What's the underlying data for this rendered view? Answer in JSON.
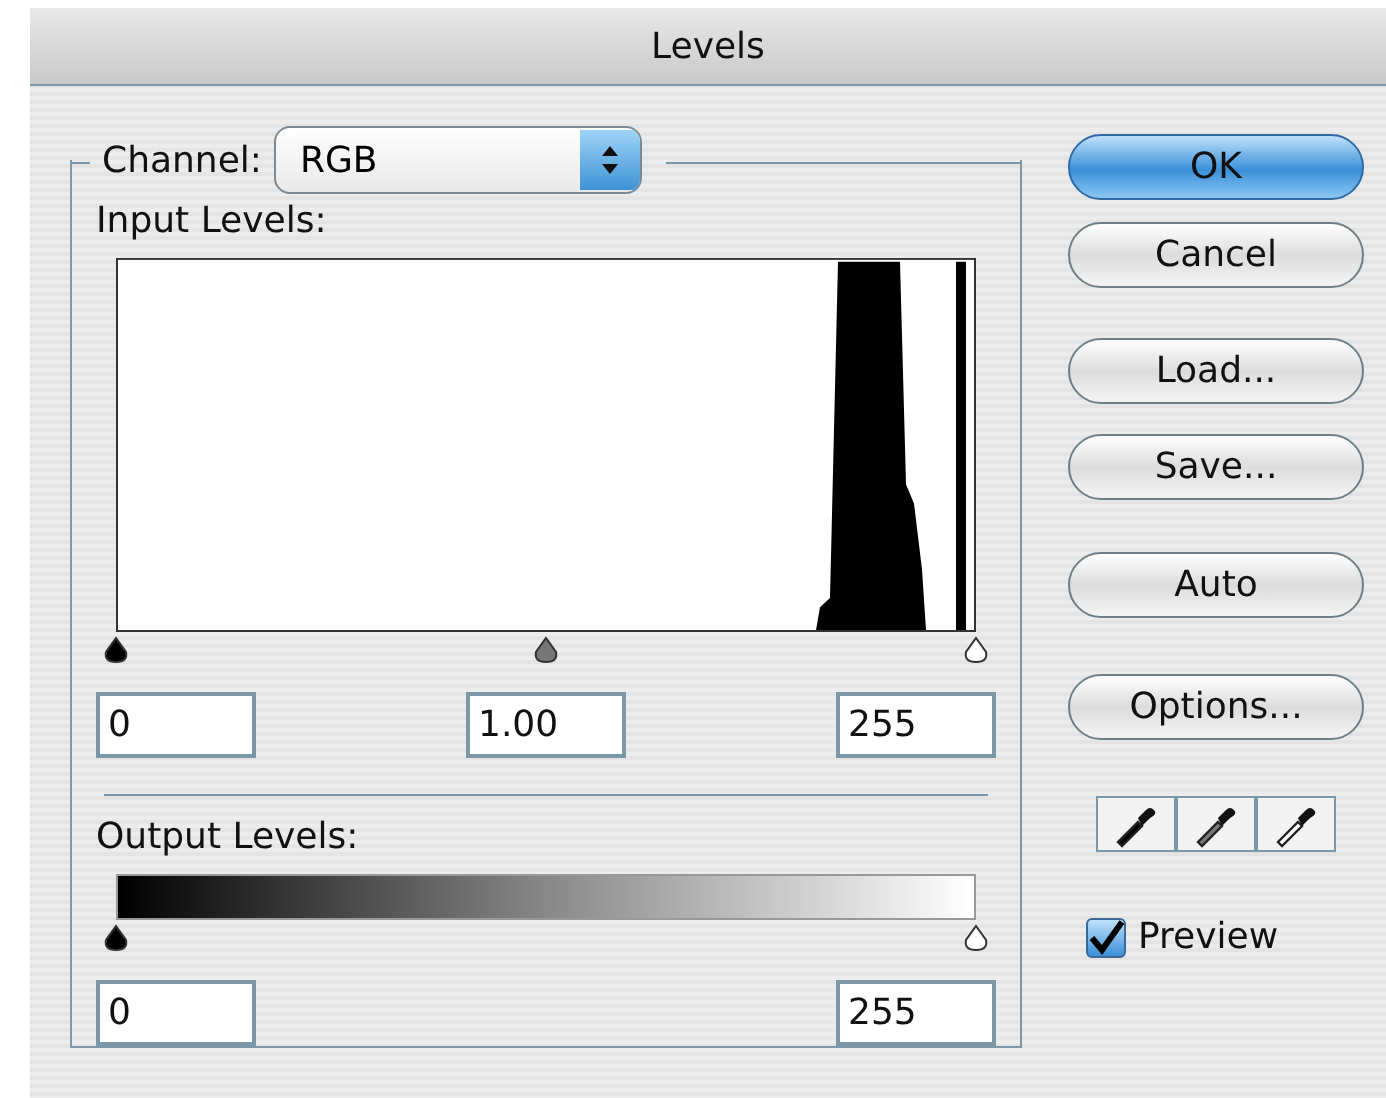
{
  "window": {
    "title": "Levels"
  },
  "channel": {
    "label": "Channel:",
    "value": "RGB"
  },
  "input_levels": {
    "label": "Input Levels:",
    "thumbs": [
      {
        "kind": "black",
        "level": 0
      },
      {
        "kind": "gray",
        "level": 0.5
      },
      {
        "kind": "white",
        "level": 1
      }
    ],
    "fields": [
      {
        "value": "0"
      },
      {
        "value": "1.00"
      },
      {
        "value": "255"
      }
    ]
  },
  "output_levels": {
    "label": "Output Levels:",
    "thumbs": [
      {
        "kind": "black",
        "level": 0
      },
      {
        "kind": "white",
        "level": 1
      }
    ],
    "fields": [
      {
        "value": "0"
      },
      {
        "value": "255"
      }
    ]
  },
  "buttons": [
    {
      "label": "OK",
      "default": true
    },
    {
      "label": "Cancel",
      "default": false
    },
    {
      "label": "Load...",
      "default": false
    },
    {
      "label": "Save...",
      "default": false
    },
    {
      "label": "Auto",
      "default": false
    },
    {
      "label": "Options...",
      "default": false
    }
  ],
  "eyedroppers": [
    {
      "kind": "black"
    },
    {
      "kind": "gray"
    },
    {
      "kind": "white"
    }
  ],
  "preview": {
    "label": "Preview",
    "checked": true
  }
}
